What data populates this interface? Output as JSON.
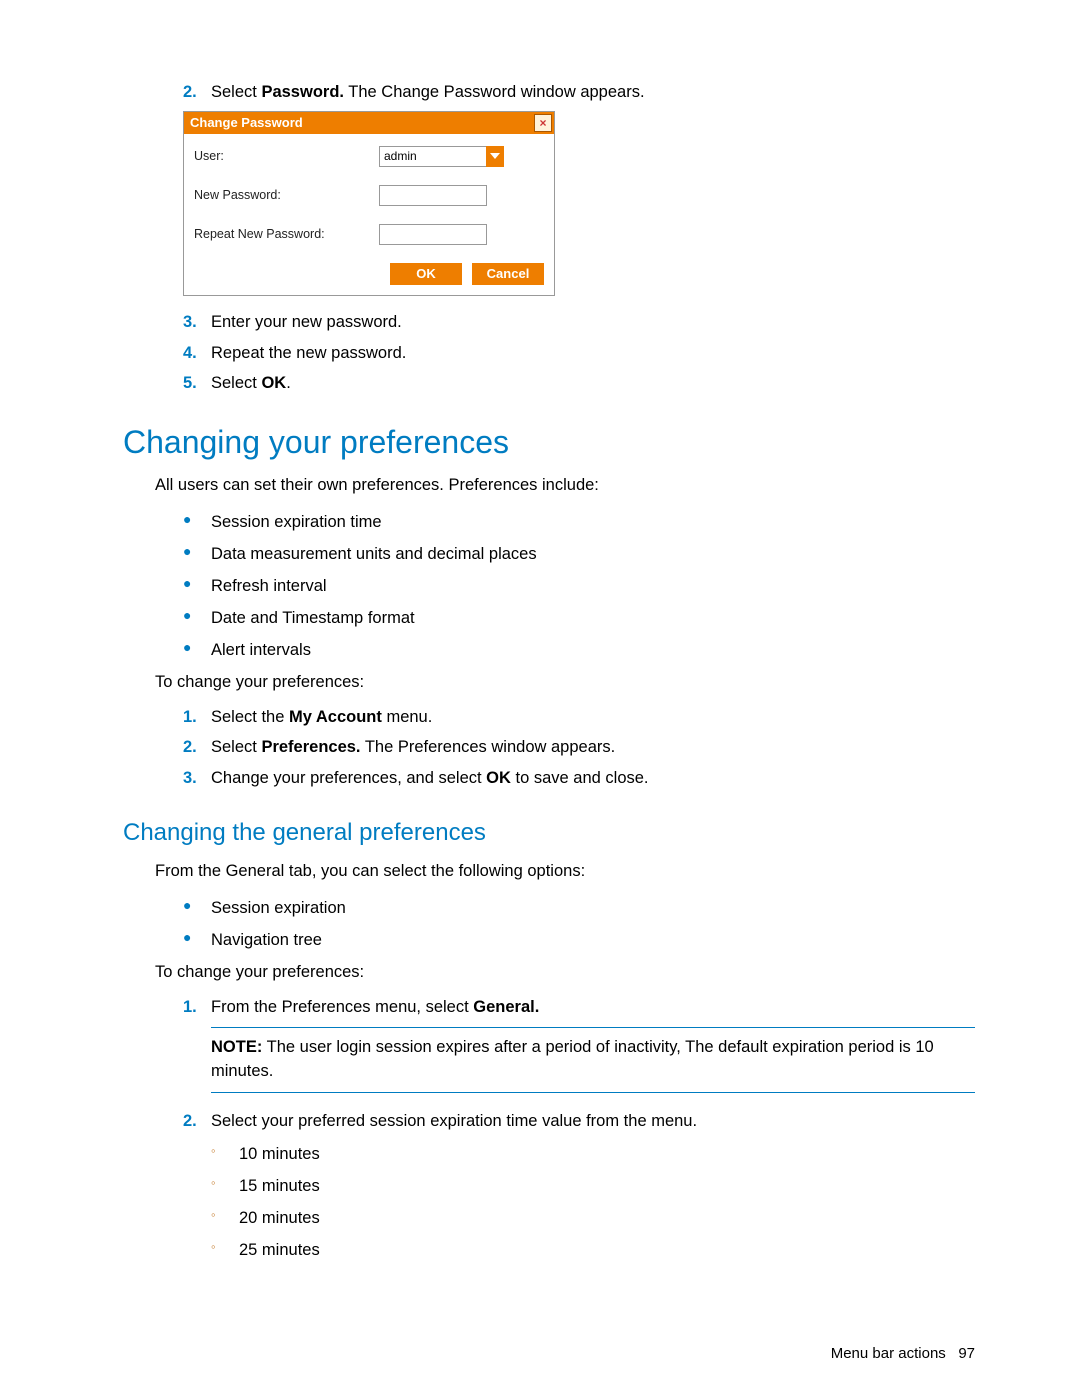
{
  "step2": {
    "num": "2.",
    "pre": "Select ",
    "bold": "Password.",
    "post": " The Change Password window appears."
  },
  "dialog": {
    "title": "Change Password",
    "close": "×",
    "user_label": "User:",
    "user_value": "admin",
    "new_pw_label": "New Password:",
    "repeat_pw_label": "Repeat New Password:",
    "ok": "OK",
    "cancel": "Cancel"
  },
  "step3": {
    "num": "3.",
    "text": "Enter your new password."
  },
  "step4": {
    "num": "4.",
    "text": "Repeat the new password."
  },
  "step5": {
    "num": "5.",
    "pre": "Select ",
    "bold": "OK",
    "post": "."
  },
  "h1": "Changing your preferences",
  "prefs_intro": "All users can set their own preferences. Preferences include:",
  "prefs_bullets": {
    "b0": "Session expiration time",
    "b1": "Data measurement units and decimal places",
    "b2": "Refresh interval",
    "b3": "Date and Timestamp format",
    "b4": "Alert intervals"
  },
  "to_change": "To change your preferences:",
  "ch1": {
    "num": "1.",
    "pre": "Select the ",
    "bold": "My Account",
    "post": " menu."
  },
  "ch2": {
    "num": "2.",
    "pre": "Select ",
    "bold": "Preferences.",
    "post": " The Preferences window appears."
  },
  "ch3": {
    "num": "3.",
    "pre": "Change your preferences, and select ",
    "bold": "OK",
    "post": " to save and close."
  },
  "h2": "Changing the general preferences",
  "gen_intro": "From the General tab, you can select the following options:",
  "gen_bullets": {
    "b0": "Session expiration",
    "b1": "Navigation tree"
  },
  "to_change2": "To change your preferences:",
  "g1": {
    "num": "1.",
    "pre": "From the Preferences menu, select ",
    "bold": "General.",
    "post": ""
  },
  "note": {
    "label": "NOTE:",
    "text": "  The user login session expires after a period of inactivity, The default expiration period is 10 minutes."
  },
  "g2": {
    "num": "2.",
    "text": "Select your preferred session expiration time value from the menu."
  },
  "times": {
    "t0": "10 minutes",
    "t1": "15 minutes",
    "t2": "20 minutes",
    "t3": "25 minutes"
  },
  "circ": "◦",
  "dot": "●",
  "footer": {
    "section": "Menu bar actions",
    "page": "97"
  }
}
